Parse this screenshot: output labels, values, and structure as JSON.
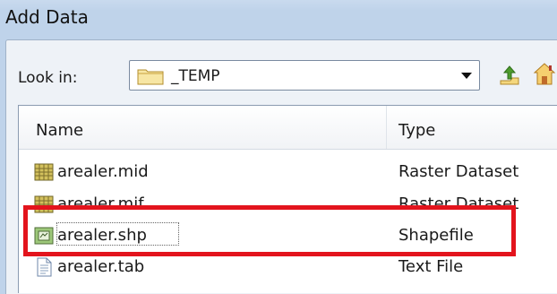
{
  "window": {
    "title": "Add Data"
  },
  "lookin": {
    "label": "Look in:",
    "selected": "_TEMP"
  },
  "toolbar": {
    "up_icon": "up-folder-icon",
    "home_icon": "home-icon"
  },
  "file_list": {
    "columns": [
      "Name",
      "Type"
    ],
    "rows": [
      {
        "name": "arealer.mid",
        "type": "Raster Dataset",
        "icon": "raster-icon"
      },
      {
        "name": "arealer.mif",
        "type": "Raster Dataset",
        "icon": "raster-icon"
      },
      {
        "name": "arealer.shp",
        "type": "Shapefile",
        "icon": "shapefile-icon"
      },
      {
        "name": "arealer.tab",
        "type": "Text File",
        "icon": "text-file-icon"
      }
    ]
  },
  "annotation": {
    "highlight_color": "#e3141d"
  }
}
